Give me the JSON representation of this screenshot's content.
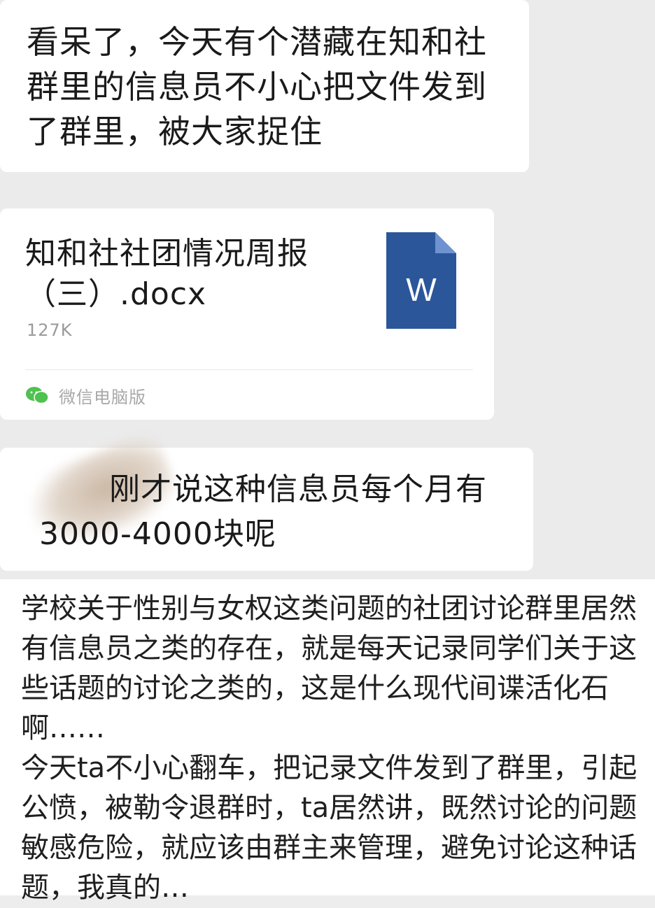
{
  "chat": {
    "message_1": "看呆了，今天有个潜藏在知和社群里的信息员不小心把文件发到了群里，被大家捉住",
    "file": {
      "name": "知和社社团情况周报（三）.docx",
      "size": "127K",
      "icon": "word-doc-icon",
      "icon_letter": "W",
      "icon_color": "#2b579a",
      "source": "微信电脑版",
      "source_icon_color": "#4fc14f"
    },
    "message_3_line1": "刚才说这种信息员每个月有",
    "message_3_line2": "3000-4000块呢"
  },
  "caption": {
    "paragraph_1": "学校关于性别与女权这类问题的社团讨论群里居然有信息员之类的存在，就是每天记录同学们关于这些话题的讨论之类的，这是什么现代间谍活化石啊……",
    "paragraph_2": "今天ta不小心翻车，把记录文件发到了群里，引起公愤，被勒令退群时，ta居然讲，既然讨论的问题敏感危险，就应该由群主来管理，避免讨论这种话题，我真的…"
  }
}
